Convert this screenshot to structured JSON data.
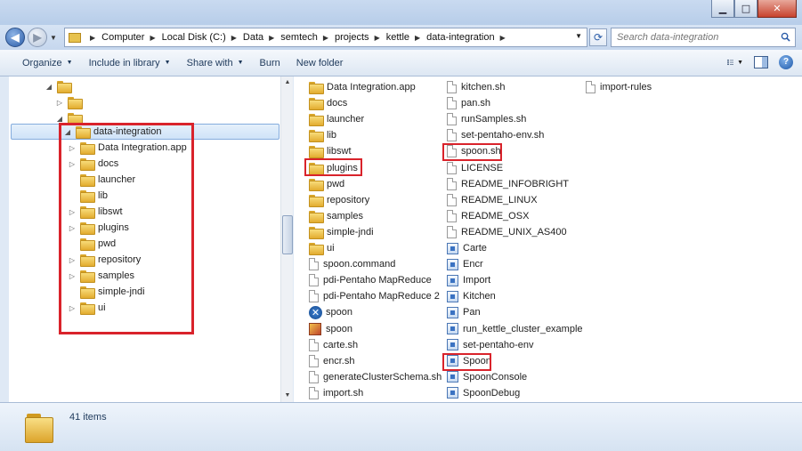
{
  "window": {
    "minimize_glyph": "▁",
    "maximize_glyph": "□",
    "close_glyph": "✕"
  },
  "nav": {
    "back_glyph": "◀",
    "forward_glyph": "▶",
    "breadcrumbs": [
      "Computer",
      "Local Disk (C:)",
      "Data",
      "semtech",
      "projects",
      "kettle",
      "data-integration"
    ],
    "search_placeholder": "Search data-integration"
  },
  "toolbar": {
    "organize": "Organize",
    "include_in_library": "Include in library",
    "share_with": "Share with",
    "burn": "Burn",
    "new_folder": "New folder"
  },
  "tree": {
    "selected": "data-integration",
    "children": [
      {
        "label": "Data Integration.app",
        "expandable": true
      },
      {
        "label": "docs",
        "expandable": true
      },
      {
        "label": "launcher",
        "expandable": false
      },
      {
        "label": "lib",
        "expandable": false
      },
      {
        "label": "libswt",
        "expandable": true
      },
      {
        "label": "plugins",
        "expandable": true
      },
      {
        "label": "pwd",
        "expandable": false
      },
      {
        "label": "repository",
        "expandable": true
      },
      {
        "label": "samples",
        "expandable": true
      },
      {
        "label": "simple-jndi",
        "expandable": false
      },
      {
        "label": "ui",
        "expandable": true
      }
    ]
  },
  "files": {
    "col1": [
      {
        "name": "Data Integration.app",
        "icon": "folder"
      },
      {
        "name": "docs",
        "icon": "folder"
      },
      {
        "name": "launcher",
        "icon": "folder"
      },
      {
        "name": "lib",
        "icon": "folder"
      },
      {
        "name": "libswt",
        "icon": "folder"
      },
      {
        "name": "plugins",
        "icon": "folder"
      },
      {
        "name": "pwd",
        "icon": "folder"
      },
      {
        "name": "repository",
        "icon": "folder"
      },
      {
        "name": "samples",
        "icon": "folder"
      },
      {
        "name": "simple-jndi",
        "icon": "folder"
      },
      {
        "name": "ui",
        "icon": "folder"
      },
      {
        "name": "spoon.command",
        "icon": "doc"
      },
      {
        "name": "pdi-Pentaho MapReduce",
        "icon": "doc"
      },
      {
        "name": "pdi-Pentaho MapReduce 2",
        "icon": "doc"
      },
      {
        "name": "spoon",
        "icon": "spoon"
      },
      {
        "name": "spoon",
        "icon": "picture"
      },
      {
        "name": "carte.sh",
        "icon": "doc"
      },
      {
        "name": "encr.sh",
        "icon": "doc"
      },
      {
        "name": "generateClusterSchema.sh",
        "icon": "doc"
      },
      {
        "name": "import.sh",
        "icon": "doc"
      }
    ],
    "col2": [
      {
        "name": "kitchen.sh",
        "icon": "doc"
      },
      {
        "name": "pan.sh",
        "icon": "doc"
      },
      {
        "name": "runSamples.sh",
        "icon": "doc"
      },
      {
        "name": "set-pentaho-env.sh",
        "icon": "doc"
      },
      {
        "name": "spoon.sh",
        "icon": "doc"
      },
      {
        "name": "LICENSE",
        "icon": "doc"
      },
      {
        "name": "README_INFOBRIGHT",
        "icon": "doc"
      },
      {
        "name": "README_LINUX",
        "icon": "doc"
      },
      {
        "name": "README_OSX",
        "icon": "doc"
      },
      {
        "name": "README_UNIX_AS400",
        "icon": "doc"
      },
      {
        "name": "Carte",
        "icon": "app"
      },
      {
        "name": "Encr",
        "icon": "app"
      },
      {
        "name": "Import",
        "icon": "app"
      },
      {
        "name": "Kitchen",
        "icon": "app"
      },
      {
        "name": "Pan",
        "icon": "app"
      },
      {
        "name": "run_kettle_cluster_example",
        "icon": "app"
      },
      {
        "name": "set-pentaho-env",
        "icon": "app"
      },
      {
        "name": "Spoon",
        "icon": "app"
      },
      {
        "name": "SpoonConsole",
        "icon": "app"
      },
      {
        "name": "SpoonDebug",
        "icon": "app"
      }
    ],
    "col3": [
      {
        "name": "import-rules",
        "icon": "doc"
      }
    ]
  },
  "status": {
    "item_count": "41 items"
  },
  "colors": {
    "highlight": "#d9232b",
    "selection": "#cfe3f8"
  }
}
